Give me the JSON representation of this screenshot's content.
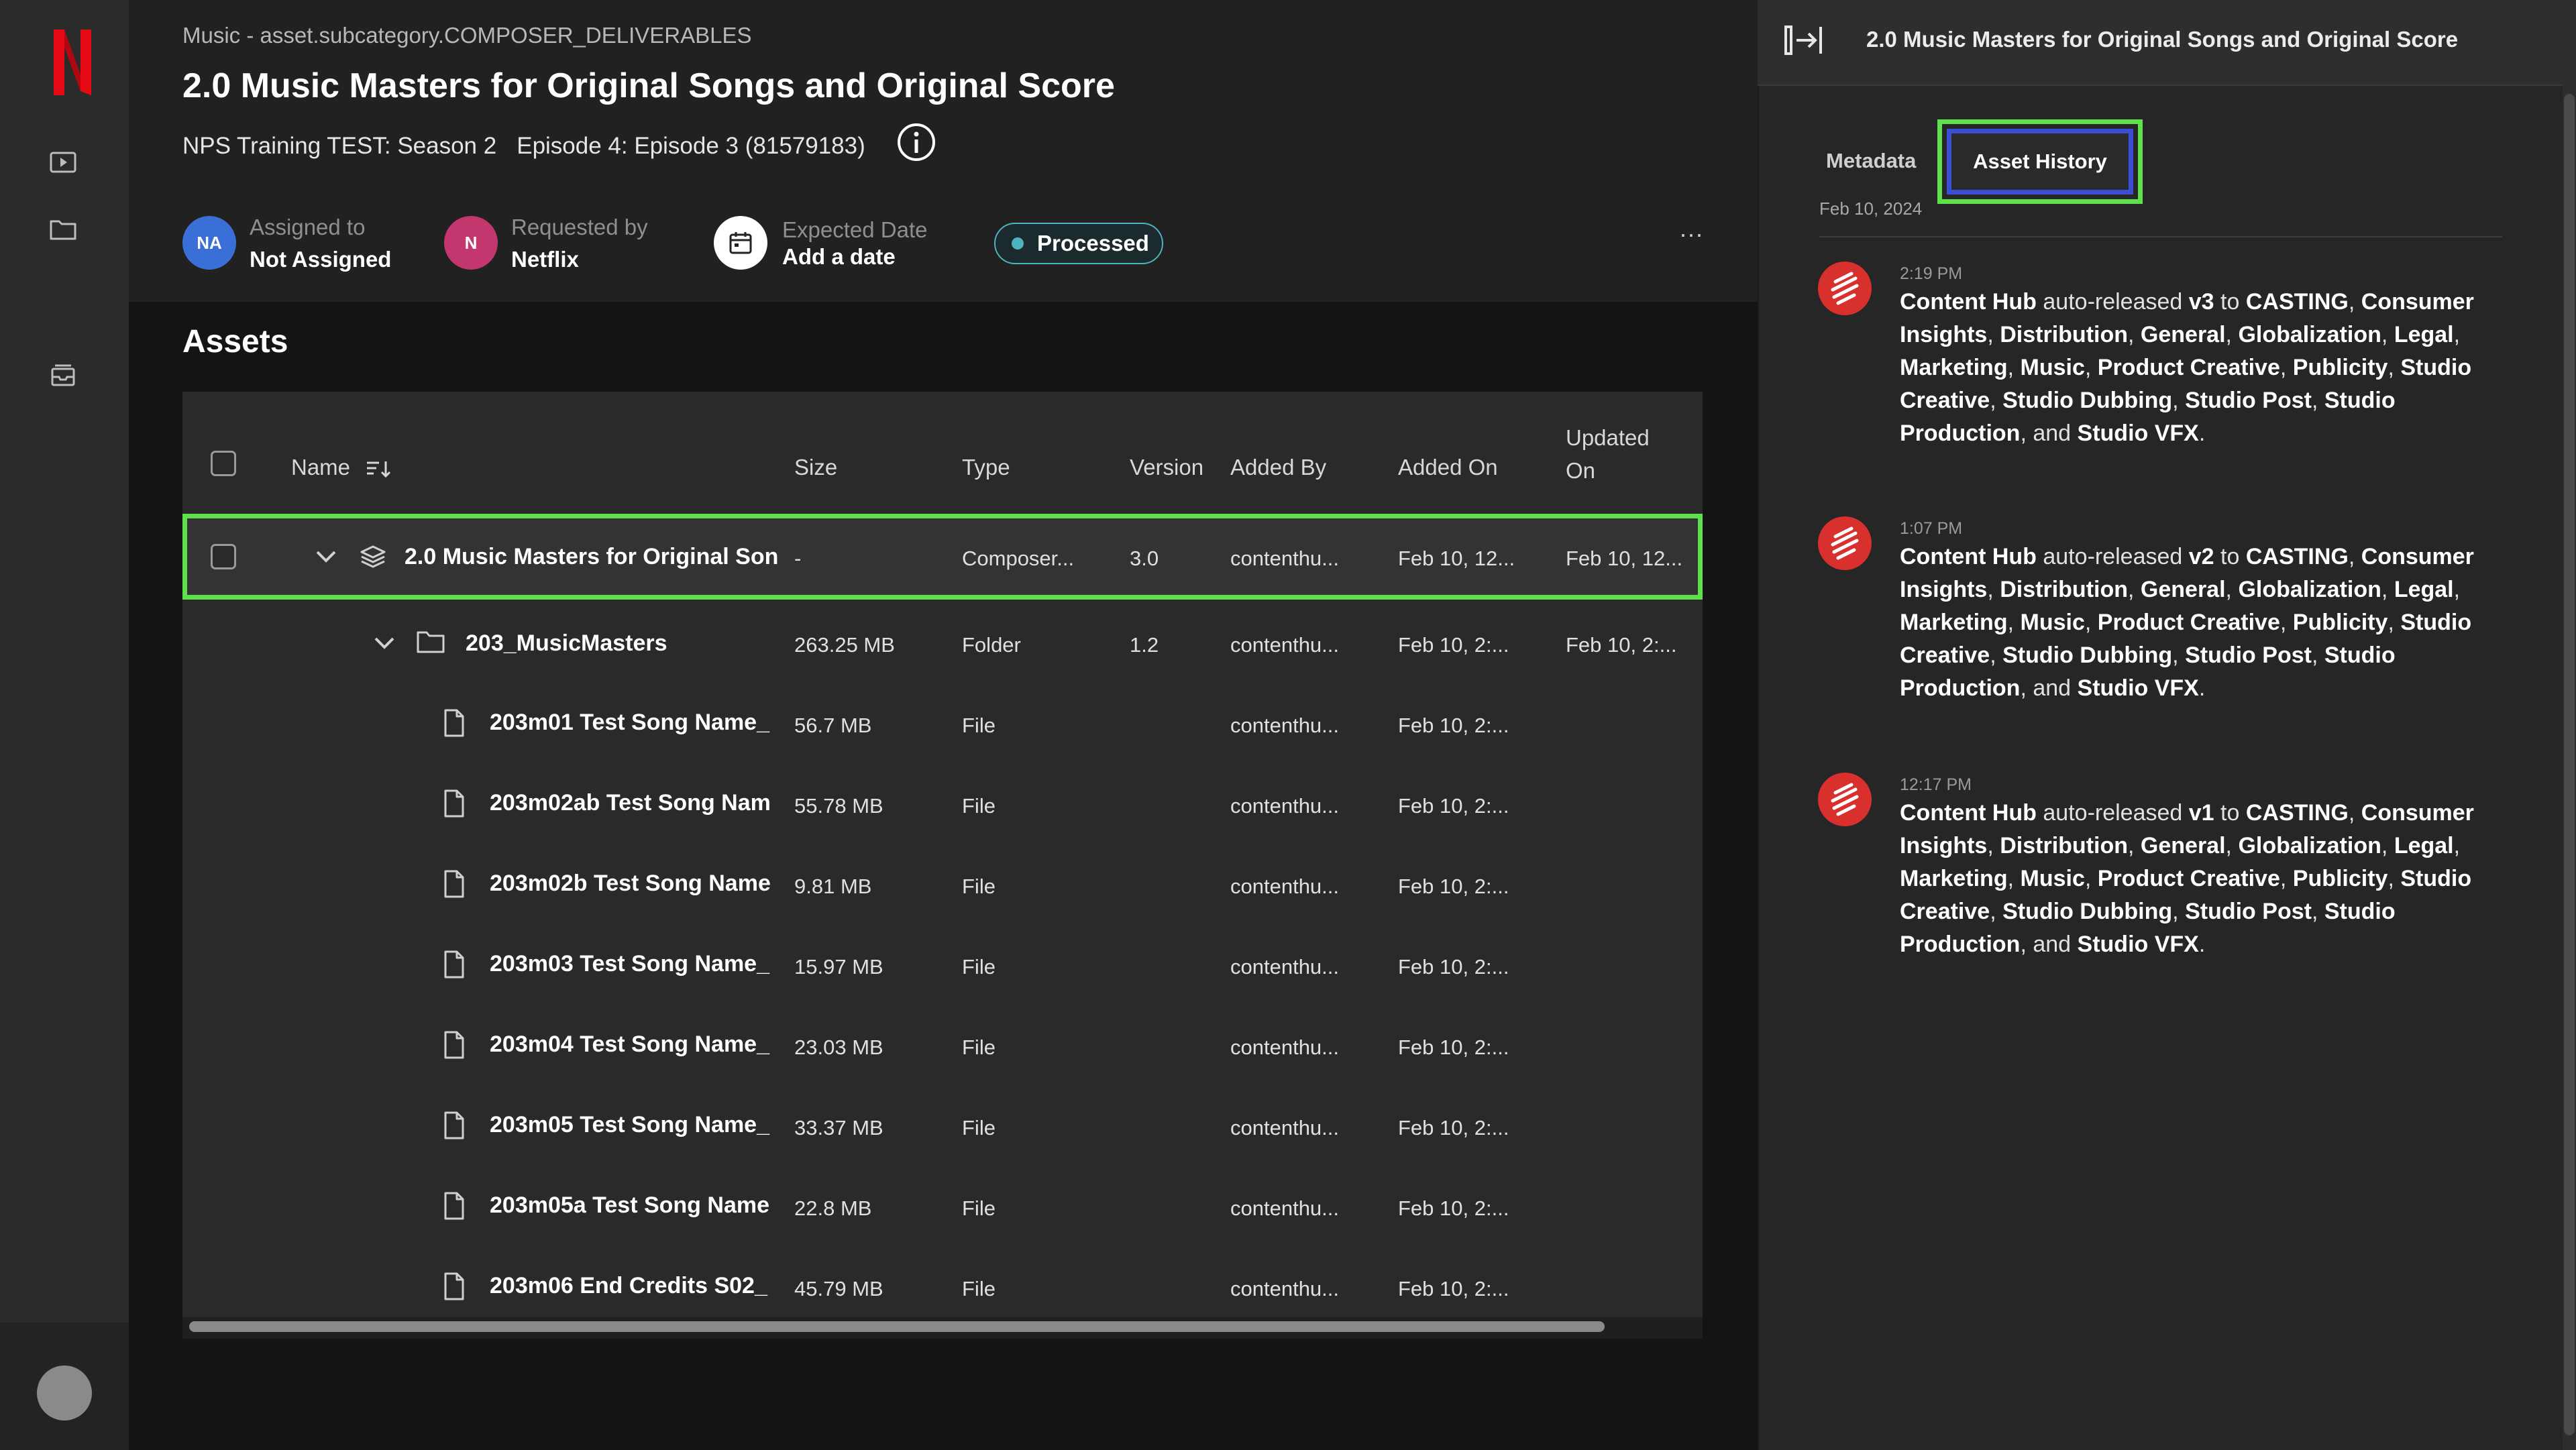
{
  "nav": {
    "logo_letter": "N",
    "icons": [
      "play-icon",
      "folder-icon",
      "inbox-icon"
    ]
  },
  "header": {
    "breadcrumb": "Music - asset.subcategory.COMPOSER_DELIVERABLES",
    "title": "2.0 Music Masters for Original Songs and Original Score",
    "season": "NPS Training TEST: Season 2",
    "episode": "Episode 4: Episode 3 (81579183)",
    "assigned": {
      "initials": "NA",
      "label": "Assigned to",
      "value": "Not Assigned",
      "color": "#3b6fd8"
    },
    "requested": {
      "initials": "N",
      "label": "Requested by",
      "value": "Netflix",
      "color": "#c4376e"
    },
    "expected": {
      "label": "Expected Date",
      "value": "Add a date"
    },
    "status": "Processed",
    "more": "···"
  },
  "assets": {
    "title": "Assets",
    "columns": {
      "name": "Name",
      "size": "Size",
      "type": "Type",
      "version": "Version",
      "added_by": "Added By",
      "added_on": "Added On",
      "updated_on_1": "Updated",
      "updated_on_2": "On"
    },
    "rows": [
      {
        "name": "2.0 Music Masters for Original Son",
        "size": "-",
        "type": "Composer...",
        "version": "3.0",
        "added_by": "contenthu...",
        "added_on": "Feb 10, 12...",
        "updated_on": "Feb 10, 12..."
      },
      {
        "name": "203_MusicMasters",
        "size": "263.25 MB",
        "type": "Folder",
        "version": "1.2",
        "added_by": "contenthu...",
        "added_on": "Feb 10, 2:...",
        "updated_on": "Feb 10, 2:..."
      },
      {
        "name": "203m01 Test Song Name_",
        "size": "56.7 MB",
        "type": "File",
        "version": "",
        "added_by": "contenthu...",
        "added_on": "Feb 10, 2:...",
        "updated_on": ""
      },
      {
        "name": "203m02ab Test Song Nam",
        "size": "55.78 MB",
        "type": "File",
        "version": "",
        "added_by": "contenthu...",
        "added_on": "Feb 10, 2:...",
        "updated_on": ""
      },
      {
        "name": "203m02b Test Song Name",
        "size": "9.81 MB",
        "type": "File",
        "version": "",
        "added_by": "contenthu...",
        "added_on": "Feb 10, 2:...",
        "updated_on": ""
      },
      {
        "name": "203m03 Test Song Name_",
        "size": "15.97 MB",
        "type": "File",
        "version": "",
        "added_by": "contenthu...",
        "added_on": "Feb 10, 2:...",
        "updated_on": ""
      },
      {
        "name": "203m04 Test Song Name_",
        "size": "23.03 MB",
        "type": "File",
        "version": "",
        "added_by": "contenthu...",
        "added_on": "Feb 10, 2:...",
        "updated_on": ""
      },
      {
        "name": "203m05 Test Song Name_",
        "size": "33.37 MB",
        "type": "File",
        "version": "",
        "added_by": "contenthu...",
        "added_on": "Feb 10, 2:...",
        "updated_on": ""
      },
      {
        "name": "203m05a Test Song Name",
        "size": "22.8 MB",
        "type": "File",
        "version": "",
        "added_by": "contenthu...",
        "added_on": "Feb 10, 2:...",
        "updated_on": ""
      },
      {
        "name": "203m06 End Credits S02_",
        "size": "45.79 MB",
        "type": "File",
        "version": "",
        "added_by": "contenthu...",
        "added_on": "Feb 10, 2:...",
        "updated_on": ""
      }
    ]
  },
  "panel": {
    "title": "2.0 Music Masters for Original Songs and Original Score",
    "tabs": {
      "metadata": "Metadata",
      "history": "Asset History"
    },
    "date": "Feb 10, 2024",
    "history": [
      {
        "time": "2:19 PM",
        "actor": "Content Hub",
        "action": "auto-released",
        "version": "v3"
      },
      {
        "time": "1:07 PM",
        "actor": "Content Hub",
        "action": "auto-released",
        "version": "v2"
      },
      {
        "time": "12:17 PM",
        "actor": "Content Hub",
        "action": "auto-released",
        "version": "v1"
      }
    ],
    "to_word": "to",
    "and_word": "and",
    "departments": [
      "CASTING",
      "Consumer Insights",
      "Distribution",
      "General",
      "Globalization",
      "Legal",
      "Marketing",
      "Music",
      "Product Creative",
      "Publicity",
      "Studio Creative",
      "Studio Dubbing",
      "Studio Post",
      "Studio Production"
    ],
    "last_department": "Studio VFX"
  }
}
